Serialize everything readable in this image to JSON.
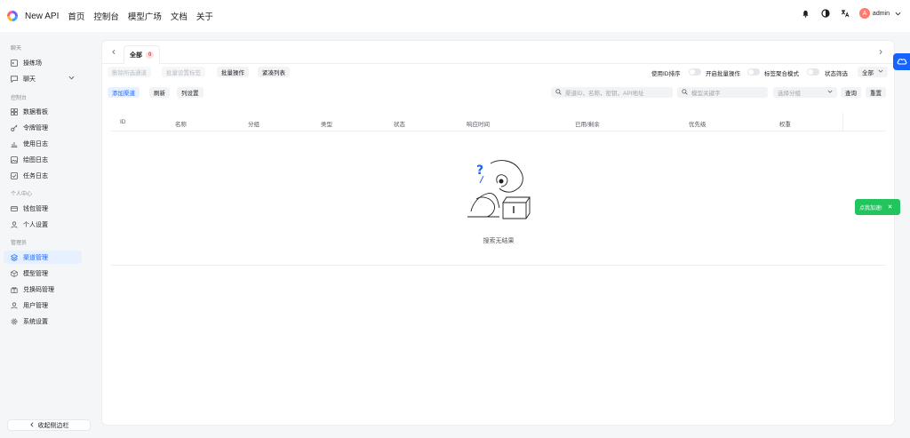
{
  "header": {
    "brand": "New API",
    "nav": [
      "首页",
      "控制台",
      "模型广场",
      "文档",
      "关于"
    ],
    "user": {
      "avatar_letter": "A",
      "name": "admin"
    }
  },
  "sidebar": {
    "sections": [
      {
        "title": "聊天",
        "items": [
          {
            "label": "操练场",
            "icon": "terminal-icon"
          },
          {
            "label": "聊天",
            "icon": "chat-icon",
            "expandable": true
          }
        ]
      },
      {
        "title": "控制台",
        "items": [
          {
            "label": "数据看板",
            "icon": "grid-icon"
          },
          {
            "label": "令牌管理",
            "icon": "key-icon"
          },
          {
            "label": "使用日志",
            "icon": "bar-chart-icon"
          },
          {
            "label": "绘图日志",
            "icon": "image-icon"
          },
          {
            "label": "任务日志",
            "icon": "checkbox-icon"
          }
        ]
      },
      {
        "title": "个人中心",
        "items": [
          {
            "label": "钱包管理",
            "icon": "wallet-icon"
          },
          {
            "label": "个人设置",
            "icon": "user-icon"
          }
        ]
      },
      {
        "title": "管理员",
        "items": [
          {
            "label": "渠道管理",
            "icon": "layers-icon",
            "active": true
          },
          {
            "label": "模型管理",
            "icon": "cube-icon"
          },
          {
            "label": "兑换码管理",
            "icon": "gift-icon"
          },
          {
            "label": "用户管理",
            "icon": "user-icon"
          },
          {
            "label": "系统设置",
            "icon": "gear-icon"
          }
        ]
      }
    ],
    "collapse_label": "收起侧边栏"
  },
  "channels": {
    "tab_label": "全部",
    "tab_count": "0",
    "bulk_actions": {
      "delete_disabled": "删除所选通道",
      "set_tag": "批量设置标签",
      "batch_op": "批量操作",
      "compact_list": "紧凑列表"
    },
    "toggles": {
      "sort_by_id": "使用ID排序",
      "enable_batch": "开启批量操作",
      "tag_aggregate": "标签聚合模式",
      "status_filter": "状态筛选"
    },
    "status_select": "全部",
    "actions": {
      "add_channel": "添加渠道",
      "refresh": "刷新",
      "column_settings": "列设置"
    },
    "search": {
      "channel_placeholder": "渠道ID，名称，密钥，API地址",
      "model_placeholder": "模型关键字",
      "group_placeholder": "选择分组",
      "query": "查询",
      "reset": "重置"
    },
    "columns": [
      "ID",
      "名称",
      "分组",
      "类型",
      "状态",
      "响应时间",
      "已用/剩余",
      "优先级",
      "权重"
    ],
    "empty_text": "搜索无结果"
  },
  "toast": {
    "label": "点我加速!"
  }
}
